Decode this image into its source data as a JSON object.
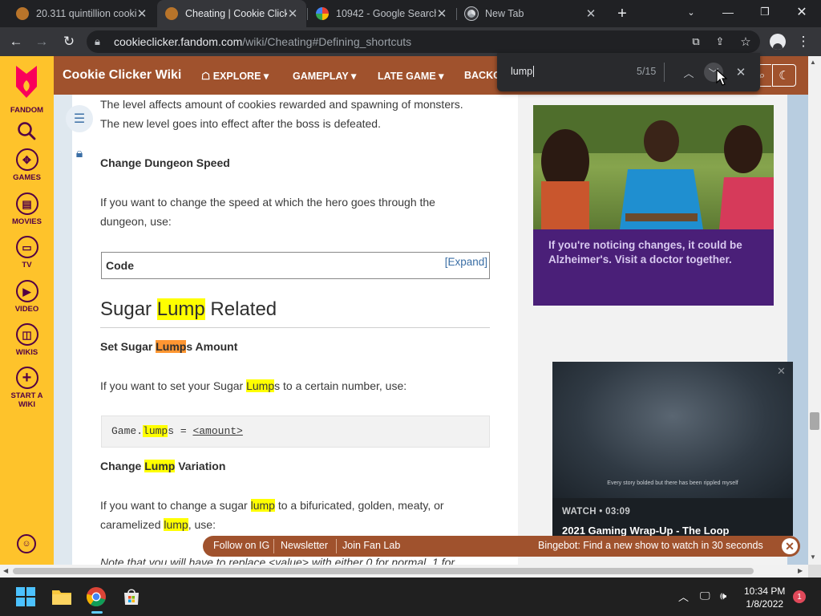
{
  "browser": {
    "tabs": [
      {
        "title": "20.311 quintillion cooki",
        "active": false
      },
      {
        "title": "Cheating | Cookie Click",
        "active": true
      },
      {
        "title": "10942 - Google Search",
        "active": false
      },
      {
        "title": "New Tab",
        "active": false
      }
    ],
    "new_tab_label": "+",
    "url_domain": "cookieclicker.fandom.com",
    "url_path": "/wiki/Cheating#Defining_shortcuts"
  },
  "find_bar": {
    "query": "lump",
    "count": "5/15"
  },
  "fandom_rail": {
    "brand": "FANDOM",
    "items": [
      {
        "label": "GAMES",
        "icon": "gamepad-icon"
      },
      {
        "label": "MOVIES",
        "icon": "film-icon"
      },
      {
        "label": "TV",
        "icon": "tv-icon"
      },
      {
        "label": "VIDEO",
        "icon": "play-icon"
      },
      {
        "label": "WIKIS",
        "icon": "book-icon"
      },
      {
        "label": "START A WIKI",
        "icon": "plus-icon"
      }
    ]
  },
  "wiki_header": {
    "name": "Cookie Clicker Wiki",
    "nav": [
      "EXPLORE",
      "GAMEPLAY",
      "LATE GAME",
      "BACKG"
    ]
  },
  "article": {
    "p_top_1": "The level affects amount of cookies rewarded and spawning of monsters.",
    "p_top_2": "The new level goes into effect after the boss is defeated.",
    "h_dungeon_speed": "Change Dungeon Speed",
    "p_speed_1": "If you want to change the speed at which the hero goes through the",
    "p_speed_2": "dungeon, use:",
    "codebox_label": "Code",
    "codebox_expand": "[Expand]",
    "h2_pre": "Sugar ",
    "h2_hl": "Lump",
    "h2_post": " Related",
    "h_set_pre": "Set Sugar ",
    "h_set_hl": "Lump",
    "h_set_post": "s Amount",
    "p_set_pre": "If you want to set your Sugar ",
    "p_set_hl": "Lump",
    "p_set_post": "s to a certain number, use:",
    "code_pre": "Game.",
    "code_hl": "lump",
    "code_post": "s = ",
    "code_arg": "<amount>",
    "h_var_pre": "Change ",
    "h_var_hl": "Lump",
    "h_var_post": " Variation",
    "p_var_1_pre": "If you want to change a sugar ",
    "p_var_1_hl": "lump",
    "p_var_1_post": " to a bifuricated, golden, meaty, or",
    "p_var_2_pre": "caramelized ",
    "p_var_2_hl": "lump",
    "p_var_2_post": ", use:",
    "p_note": "Note that you will have to replace <value> with either 0 for normal, 1 for"
  },
  "ad": {
    "text": "If you're noticing changes, it could be Alzheimer's. Visit a doctor together."
  },
  "video": {
    "caption": "Every story bolded but there has been rippled myself",
    "watch": "WATCH • 03:09",
    "title": "2021 Gaming Wrap-Up - The Loop"
  },
  "bottom_bar": {
    "links": [
      "Follow on IG",
      "Newsletter",
      "Join Fan Lab"
    ],
    "promo": "Bingebot: Find a new show to watch in 30 seconds"
  },
  "taskbar": {
    "time": "10:34 PM",
    "date": "1/8/2022",
    "notification_count": "1"
  },
  "colors": {
    "fandom_yellow": "#fec32b",
    "wiki_brown": "#a0522d",
    "find_highlight": "#ffff00",
    "find_current": "#ff9632"
  }
}
